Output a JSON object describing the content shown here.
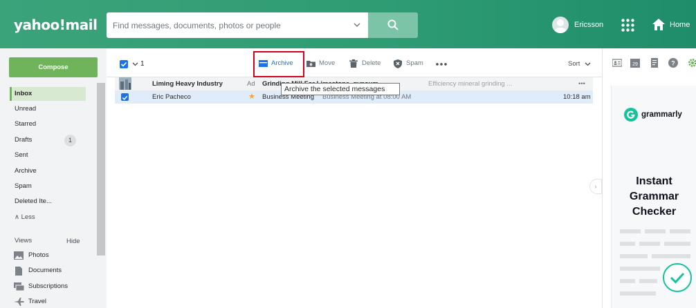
{
  "header": {
    "logo": "yahoo!mail",
    "search_placeholder": "Find messages, documents, photos or people",
    "user_name": "Ericsson",
    "home_label": "Home"
  },
  "sidebar": {
    "compose_label": "Compose",
    "folders": [
      {
        "label": "Inbox",
        "active": true
      },
      {
        "label": "Unread"
      },
      {
        "label": "Starred"
      },
      {
        "label": "Drafts",
        "count": "1"
      },
      {
        "label": "Sent"
      },
      {
        "label": "Archive"
      },
      {
        "label": "Spam"
      },
      {
        "label": "Deleted Ite..."
      }
    ],
    "less_label": "∧ Less",
    "views_label": "Views",
    "hide_label": "Hide",
    "views": [
      {
        "label": "Photos",
        "icon": "photo-icon"
      },
      {
        "label": "Documents",
        "icon": "document-icon"
      },
      {
        "label": "Subscriptions",
        "icon": "subscriptions-icon"
      },
      {
        "label": "Travel",
        "icon": "plane-icon"
      }
    ]
  },
  "toolbar": {
    "selected_count": "1",
    "archive_label": "Archive",
    "move_label": "Move",
    "delete_label": "Delete",
    "spam_label": "Spam",
    "sort_label": "Sort",
    "tooltip": "Archive the selected messages"
  },
  "messages": {
    "ad": {
      "sender": "Liming Heavy Industry",
      "ad_label": "Ad",
      "subject": "Grinding Mill For Limestone, gypsum",
      "snippet": "Efficiency mineral grinding ..."
    },
    "items": [
      {
        "sender": "Eric Pacheco",
        "subject": "Business Meeting",
        "snippet": "Business Meeting at 08:00 AM",
        "time": "10:18 am",
        "starred": true,
        "selected": true
      }
    ]
  },
  "right_ad": {
    "brand": "grammarly",
    "headline_1": "Instant",
    "headline_2": "Grammar",
    "headline_3": "Checker"
  },
  "colors": {
    "header_green": "#2f9c74",
    "compose_green": "#6fb45a",
    "selection_blue": "#1a73e8",
    "grammarly_green": "#15c39a",
    "highlight_red": "#d0021b"
  }
}
